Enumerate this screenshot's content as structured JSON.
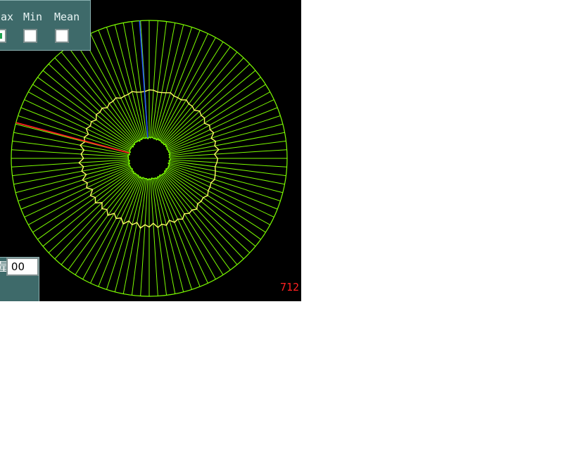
{
  "plot": {
    "background_color": "#000000",
    "spoke_color": "#7cfc00",
    "mean_ring_color": "#ffff66",
    "max_marker_color": "#2050ff",
    "min_marker_color": "#ff2020",
    "spoke_count": 100,
    "outer_level": 1.0,
    "mean_level": 0.49,
    "inner_level": 0.15,
    "max_marker_angle_deg": -94,
    "min_marker_angle_deg": 195,
    "counter_text": "712"
  },
  "stats_panel": {
    "max_label": "ax",
    "min_label": "Min",
    "mean_label": "Mean",
    "max_checked": true,
    "min_checked": false,
    "mean_checked": false
  },
  "range_panel": {
    "label": "量程",
    "value": "00"
  }
}
